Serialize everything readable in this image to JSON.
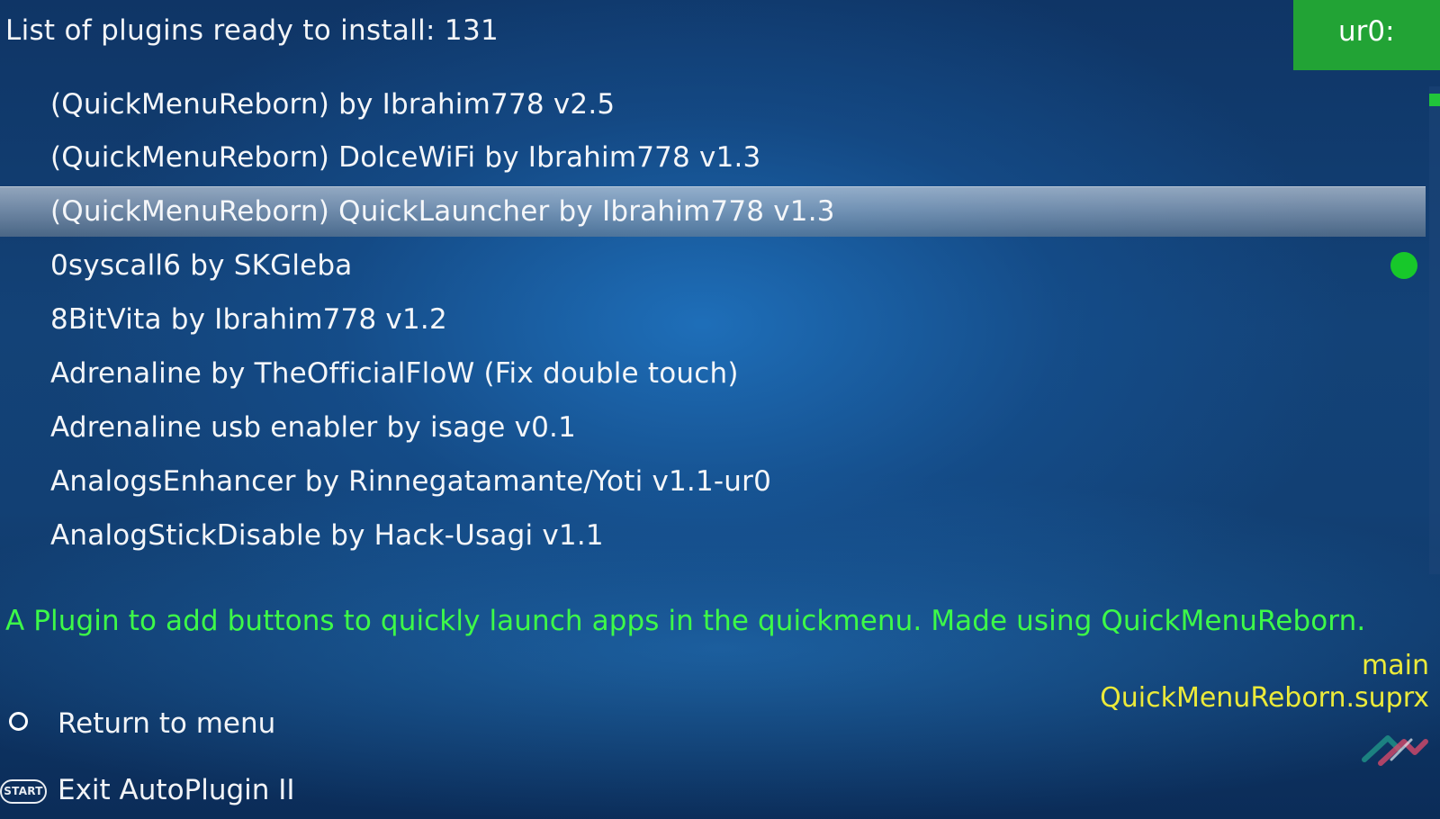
{
  "header": {
    "title": "List of plugins ready to install: 131",
    "partition": "ur0:"
  },
  "plugins": [
    {
      "label": "(QuickMenuReborn) by Ibrahim778  v2.5",
      "selected": false,
      "installed": false
    },
    {
      "label": "(QuickMenuReborn) DolceWiFi by Ibrahim778  v1.3",
      "selected": false,
      "installed": false
    },
    {
      "label": "(QuickMenuReborn) QuickLauncher by Ibrahim778  v1.3",
      "selected": true,
      "installed": false
    },
    {
      "label": "0syscall6 by SKGleba",
      "selected": false,
      "installed": true
    },
    {
      "label": "8BitVita by Ibrahim778  v1.2",
      "selected": false,
      "installed": false
    },
    {
      "label": "Adrenaline by TheOfficialFloW (Fix double touch)",
      "selected": false,
      "installed": false
    },
    {
      "label": "Adrenaline usb enabler by isage  v0.1",
      "selected": false,
      "installed": false
    },
    {
      "label": "AnalogsEnhancer by Rinnegatamante/Yoti  v1.1-ur0",
      "selected": false,
      "installed": false
    },
    {
      "label": "AnalogStickDisable by Hack-Usagi  v1.1",
      "selected": false,
      "installed": false
    }
  ],
  "details": {
    "description": "A Plugin to add buttons to quickly launch apps in the quickmenu. Made using QuickMenuReborn.",
    "section": "main",
    "file": "QuickMenuReborn.suprx"
  },
  "actions": {
    "return_icon": "circle-button-icon",
    "return_label": "Return to menu",
    "exit_icon_text": "START",
    "exit_label": "Exit AutoPlugin II"
  },
  "colors": {
    "installed_indicator": "#17c82a",
    "partition_badge": "#22a335",
    "description_text": "#3dfa48",
    "file_text": "#ecea3a"
  }
}
